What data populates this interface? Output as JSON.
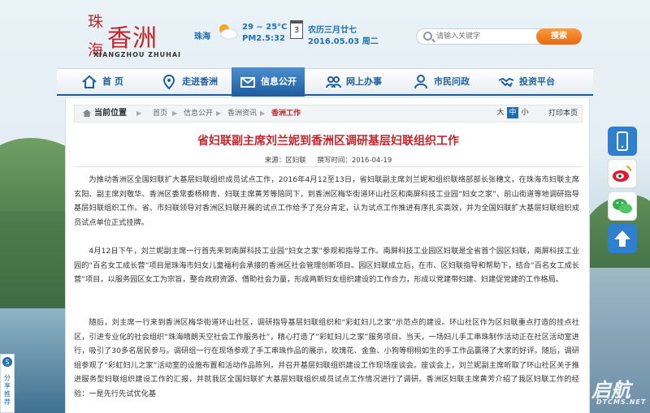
{
  "site": {
    "logo_cn": "珠海香洲",
    "logo_cn_top": "珠",
    "logo_cn_bottom": "海",
    "logo_cn_main": "香洲",
    "logo_en": "XIANGZHOU ZHUHAI"
  },
  "weather": {
    "city": "珠海",
    "temp": "29 ~ 25°C",
    "pm": "PM2.5:32",
    "calendar_day": "3",
    "lunar": "农历三月廿七",
    "date": "2016.05.03 周二"
  },
  "search": {
    "placeholder": "请输入关键字",
    "button": "搜索"
  },
  "nav": {
    "home": "首 页",
    "enter": "走进香洲",
    "info": "信息公开",
    "online": "网上办事",
    "ask": "市民问政",
    "invest": "投资平台"
  },
  "breadcrumb": {
    "current_label": "当前位置",
    "items": [
      "首页",
      "信息公开",
      "香洲资讯",
      "香洲工作"
    ]
  },
  "font_size": {
    "large": "大",
    "medium": "中",
    "small": "小"
  },
  "print": "打印本页",
  "article": {
    "title": "省妇联副主席刘兰妮到香洲区调研基层妇联组织工作",
    "source_label": "来源：",
    "source": "区妇联",
    "time_label": "撰写时间：",
    "time": "2016-04-19",
    "paragraphs": [
      "为推动香洲区全国妇联扩大基层妇联组织成员试点工作，2016年4月12至13日，省妇联副主席刘兰妮和组织联络部部长张穗文，在珠海市妇联主席玄阳、副主席刘敬华、香洲区委常委杨柳青、妇联主席黄芳等陪同下，到香洲区梅华街道环山社区和南屏科技工业园“妇女之家”、前山街道等地调研指导基层妇联组织工作。省、市妇联领导对香洲区妇联开展的试点工作给予了充分肯定，认为试点工作推进有序扎实高效，并为全国妇联扩大基层妇联组织成员试点单位正式挂牌。",
      "4月12日下午，刘兰妮副主席一行首先来到南屏科技工业园“妇女之家”参观和指导工作。南屏科技工业园区妇联是全省首个园区妇联，南屏科技工业园的“百名女工成长营”项目是珠海市妇女儿童福利会承接的香洲区社会管理创新项目。园区妇联成立后，在市、区妇联指导和帮助下，结合“百名女工成长营”项目，以服务园区女工为宗旨，整合政府资源、借助社会力量，形成两新妇女组织建设的工作合力，形成以党建带妇建、妇建促党建的工作格局。",
      "随后，刘主席一行来到香洲区梅华街道环山社区，调研指导基层妇联组织和“彩虹妇儿之家”示范点的建设。环山社区作为区妇联重点打造的挂点社区，引进专业化的社会组织“珠海晴朗天空社会工作服务社”，精心打造了“彩虹妇儿之家”服务项目。当天，一场妇儿手工串珠制作活动正在社区活动室进行，吸引了30多名居民参与。调研组一行在现场参观了手工串珠作品的展示，玫瑰花、金鱼、小狗等栩栩如生的手工作品赢得了大家的好评。随后，调研组参观了“彩虹妇儿之家”活动室的设施布置和活动作品陈列，并召开基层妇联组织建设工作现场座谈会。座谈会上，刘兰妮副主席听取了环山社区关于推进服务型妇联组织建设工作的汇报，并就我区全国妇联扩大基层妇联组织成员试点工作情况进行了调研。香洲区妇联主席黄芳介绍了我区妇联工作的经验：一是先行先试优化基"
    ]
  },
  "share_label": "分享推荐",
  "watermark": {
    "main": "启航",
    "sub": "DTCMS.NET"
  },
  "colors": {
    "brand_red": "#c0262b",
    "nav_blue": "#1d5c9c",
    "search_orange": "#e46a12"
  }
}
